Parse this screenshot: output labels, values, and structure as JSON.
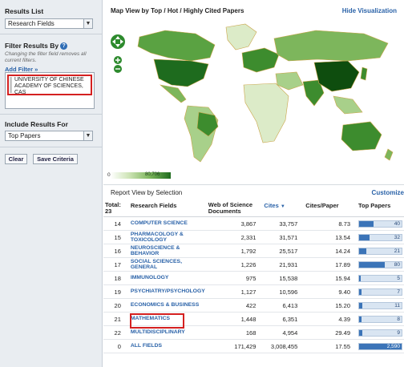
{
  "sidebar": {
    "results_list_title": "Results List",
    "results_list_value": "Research Fields",
    "filter_title": "Filter Results By",
    "filter_note": "Changing the filter field removes all current filters.",
    "add_filter_label": "Add Filter »",
    "filter_value": "UNIVERSITY OF CHINESE ACADEMY OF SCIENCES, CAS",
    "include_title": "Include Results For",
    "include_value": "Top Papers",
    "clear_label": "Clear",
    "save_label": "Save Criteria"
  },
  "main": {
    "map_title": "Map View by Top / Hot / Highly Cited Papers",
    "hide_viz_label": "Hide Visualization",
    "legend_min": "0",
    "legend_max": "80,706",
    "report_title": "Report View by Selection",
    "customize_label": "Customize",
    "total_label": "Total:",
    "total_value": "23",
    "columns": {
      "field": "Research Fields",
      "wos": "Web of Science Documents",
      "cites": "Cites",
      "sort_marker": "▼",
      "cites_per_paper": "Cites/Paper",
      "top_papers": "Top Papers"
    },
    "rows": [
      {
        "rank": "14",
        "field": "COMPUTER SCIENCE",
        "wos": "3,867",
        "cites": "33,757",
        "cpp": "8.73",
        "top": "40",
        "top_fraction": 0.34
      },
      {
        "rank": "15",
        "field": "PHARMACOLOGY & TOXICOLOGY",
        "wos": "2,331",
        "cites": "31,571",
        "cpp": "13.54",
        "top": "32",
        "top_fraction": 0.25
      },
      {
        "rank": "16",
        "field": "NEUROSCIENCE & BEHAVIOR",
        "wos": "1,792",
        "cites": "25,517",
        "cpp": "14.24",
        "top": "21",
        "top_fraction": 0.17
      },
      {
        "rank": "17",
        "field": "SOCIAL SCIENCES, GENERAL",
        "wos": "1,226",
        "cites": "21,931",
        "cpp": "17.89",
        "top": "80",
        "top_fraction": 0.6
      },
      {
        "rank": "18",
        "field": "IMMUNOLOGY",
        "wos": "975",
        "cites": "15,538",
        "cpp": "15.94",
        "top": "5",
        "top_fraction": 0.04
      },
      {
        "rank": "19",
        "field": "PSYCHIATRY/PSYCHOLOGY",
        "wos": "1,127",
        "cites": "10,596",
        "cpp": "9.40",
        "top": "7",
        "top_fraction": 0.05
      },
      {
        "rank": "20",
        "field": "ECONOMICS & BUSINESS",
        "wos": "422",
        "cites": "6,413",
        "cpp": "15.20",
        "top": "11",
        "top_fraction": 0.08
      },
      {
        "rank": "21",
        "field": "MATHEMATICS",
        "wos": "1,448",
        "cites": "6,351",
        "cpp": "4.39",
        "top": "8",
        "top_fraction": 0.06
      },
      {
        "rank": "22",
        "field": "MULTIDISCIPLINARY",
        "wos": "168",
        "cites": "4,954",
        "cpp": "29.49",
        "top": "9",
        "top_fraction": 0.07
      },
      {
        "rank": "0",
        "field": "ALL FIELDS",
        "wos": "171,429",
        "cites": "3,008,455",
        "cpp": "17.55",
        "top": "2,590",
        "top_fraction": 1.0
      }
    ]
  },
  "colors": {
    "accent": "#2a62a8",
    "highlight": "#d42020",
    "map_dark": "#1e6b1e",
    "map_light": "#cfe5b8"
  }
}
